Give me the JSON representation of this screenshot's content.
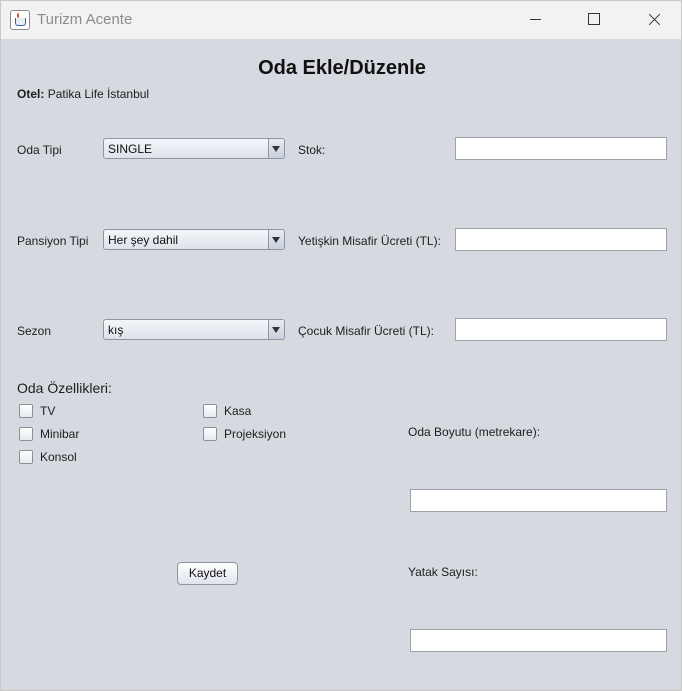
{
  "window": {
    "title": "Turizm Acente"
  },
  "form": {
    "heading": "Oda Ekle/Düzenle",
    "hotel_label": "Otel:",
    "hotel_value": "Patika Life İstanbul",
    "room_type_label": "Oda Tipi",
    "room_type_value": "SINGLE",
    "board_type_label": "Pansiyon Tipi",
    "board_type_value": "Her şey dahil",
    "season_label": "Sezon",
    "season_value": "kış",
    "stock_label": "Stok:",
    "stock_value": "",
    "adult_price_label": "Yetişkin Misafir Ücreti (TL):",
    "adult_price_value": "",
    "child_price_label": "Çocuk Misafir Ücreti (TL):",
    "child_price_value": "",
    "features_title": "Oda Özellikleri:",
    "features": {
      "tv": "TV",
      "minibar": "Minibar",
      "console": "Konsol",
      "safe": "Kasa",
      "projector": "Projeksiyon"
    },
    "room_size_label": "Oda Boyutu (metrekare):",
    "room_size_value": "",
    "bed_count_label": "Yatak Sayısı:",
    "bed_count_value": "",
    "save_label": "Kaydet"
  }
}
